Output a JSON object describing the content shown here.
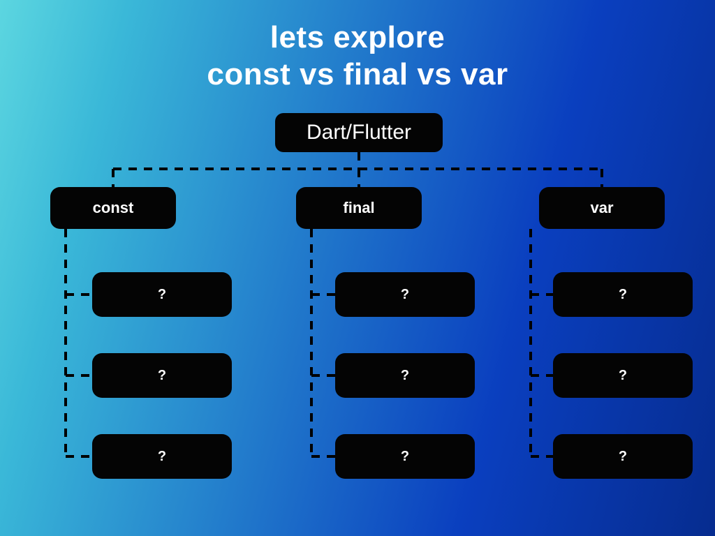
{
  "title": {
    "line1": "lets explore",
    "line2": "const vs final vs var"
  },
  "root": {
    "label": "Dart/Flutter"
  },
  "branches": [
    {
      "id": "const",
      "label": "const",
      "leaves": [
        "?",
        "?",
        "?"
      ]
    },
    {
      "id": "final",
      "label": "final",
      "leaves": [
        "?",
        "?",
        "?"
      ]
    },
    {
      "id": "var",
      "label": "var",
      "leaves": [
        "?",
        "?",
        "?"
      ]
    }
  ]
}
